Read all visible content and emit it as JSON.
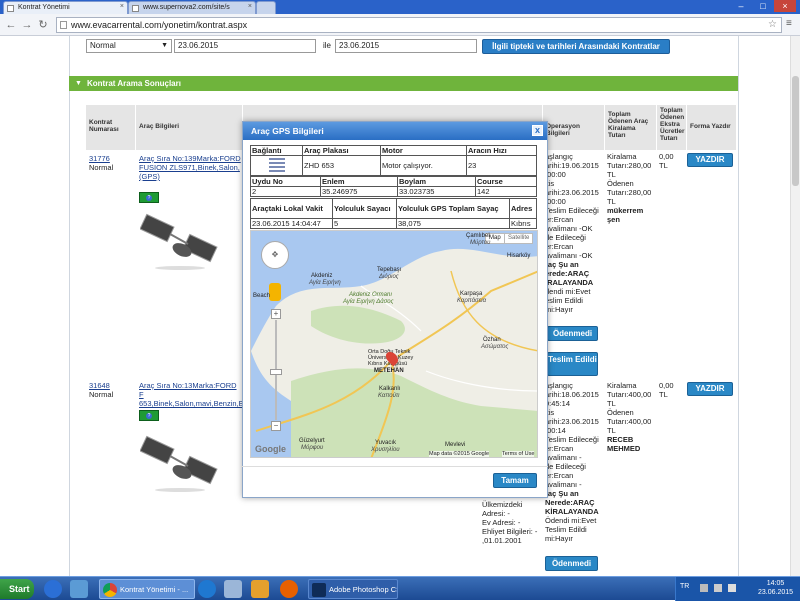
{
  "browser": {
    "tabs": [
      {
        "label": "Kontrat Yönetimi",
        "active": true
      },
      {
        "label": "www.supernova2.com/site/s",
        "active": false
      }
    ],
    "url": "www.evacarrental.com/yonetim/kontrat.aspx"
  },
  "filter": {
    "type_value": "Normal",
    "date_from": "23.06.2015",
    "between_label": "ile",
    "date_to": "23.06.2015",
    "search_button": "İlgili tipteki ve tarihleri Arasındaki Kontratlar"
  },
  "section": {
    "title": "Kontrat Arama Sonuçları"
  },
  "table": {
    "headers": {
      "number": "Kontrat Numarası",
      "vehicle": "Araç Bilgileri",
      "operation": "Operasyon Bilgileri",
      "total": "Toplam Ödenen Araç Kiralama Tutarı",
      "extra": "Toplam Ödenen Ekstra Ücretler Tutarı",
      "print": "Forma Yazdır"
    },
    "rows": [
      {
        "number": "31776",
        "type": "Normal",
        "vehicle": "Araç Sıra No:139Marka:FORD FUSION ZLS971,Binek,Salon,(GPS)",
        "operation": [
          "aşlangıç",
          "arihi:19.06.2015",
          ":00:00",
          "itis",
          "arihi:23.06.2015",
          ":00:00",
          "Teslim Edileceği",
          "er:Ercan",
          "avalimanı -OK",
          "de Edileceği",
          "er:Ercan",
          "avalimanı -OK",
          "raç Şu an",
          "erede:ARAÇ",
          "İRALAYANDA",
          "dendi mi:Evet",
          "eslim Edildi",
          "mi:Hayır"
        ],
        "total": [
          "Kiralama",
          "Tutarı:280,00",
          "TL",
          "Ödenen",
          "Tutarı:280,00",
          "TL"
        ],
        "total_bold": "mükerrem şen",
        "extra": [
          "0,00",
          "TL"
        ],
        "paid_button": "Ödenmedi",
        "delivered_button": "Teslim Edildi",
        "print_button": "YAZDIR"
      },
      {
        "number": "31648",
        "type": "Normal",
        "vehicle": "Araç Sıra No:13Marka:FORD F 653,Binek,Salon,mavi,Benzin,E",
        "operation": [
          "aşlangıç",
          "arihi:18.06.2015",
          "9:45:14",
          "itis",
          "arihi:23.06.2015",
          ":00:14",
          "Teslim Edileceği",
          "er:Ercan",
          "avalimanı -",
          "de Edileceği",
          "er:Ercan",
          "avalimanı -"
        ],
        "operation_bold": [
          "raç Şu an",
          "Nerede:ARAÇ",
          "KİRALAYANDA"
        ],
        "operation_tail": [
          "Ödendi mi:Evet",
          "Teslim Edildi",
          "mi:Hayır"
        ],
        "left_tail": [
          "Ülkemizdeki",
          "Adresi: -",
          "Ev Adresi: -",
          "Ehliyet Bilgileri: -",
          ",01.01.2001"
        ],
        "total": [
          "Kiralama",
          "Tutarı:400,00",
          "TL",
          "Ödenen",
          "Tutarı:400,00",
          "TL"
        ],
        "total_bold": "RECEB MEHMED",
        "extra": [
          "0,00",
          "TL"
        ],
        "paid_button": "Ödenmedi",
        "print_button": "YAZDIR"
      }
    ]
  },
  "gps_dialog": {
    "title": "Araç GPS Bilgileri",
    "close": "x",
    "table1": {
      "headers": [
        "Bağlantı",
        "Araç Plakası",
        "Motor",
        "Aracın Hızı"
      ],
      "values": [
        "",
        "ZHD 653",
        "Motor çalışıyor.",
        "23"
      ]
    },
    "table2": {
      "headers": [
        "Uydu No",
        "Enlem",
        "Boylam",
        "Course"
      ],
      "values": [
        "2",
        "35.246975",
        "33.023735",
        "142"
      ]
    },
    "table3": {
      "headers": [
        "Araçtaki Lokal Vakit",
        "Yolculuk Sayacı",
        "Yolculuk GPS Toplam Sayaç",
        "Adres"
      ],
      "values": [
        "23.06.2015 14:04:47",
        "5",
        "38,075",
        "Kıbrıs"
      ]
    },
    "map": {
      "type_map": "Map",
      "type_sat": "Satellite",
      "labels": {
        "camlibel": "Çamlıbel",
        "camlibel_gr": "Μύρτου",
        "hisarkoy": "Hisarköy",
        "akdeniz": "Akdeniz",
        "akdeniz_gr": "Αγία Ειρήνη",
        "tepebasi": "Tepebaşı",
        "tepebasi_gr": "Διόριος",
        "karpasa": "Karpaşa",
        "karpasa_gr": "Καρπάσεια",
        "forest": "Akdeniz Ormanı",
        "forest_gr": "Αγία Ειρήνη Δάσος",
        "beach": "Beach",
        "ozhan": "Özhan",
        "ozhan_gr": "Ασώματος",
        "uni": "Orta Doğu Teknik Üniversitesi Kuzey Kıbrıs Kampüsü",
        "mecnon": "METEHAN",
        "kalkanli": "Kalkanlı",
        "kalkanli_gr": "Καπούτι",
        "guzelyurt": "Güzelyurt",
        "guzelyurt_gr": "Μόρφου",
        "yuvacik": "Yuvacık",
        "yuvacik_gr": "Χρυσηλίου",
        "mevlevi": "Mevlevi",
        "google": "Google",
        "attribution": "Map data ©2015 Google",
        "terms": "Terms of Use"
      }
    },
    "ok_button": "Tamam"
  },
  "taskbar": {
    "start": "Start",
    "items": [
      "Kontrat Yönetimi - ...",
      "Adobe Photoshop CS..."
    ],
    "lang": "TR",
    "time": "14:05",
    "date": "23.06.2015"
  }
}
